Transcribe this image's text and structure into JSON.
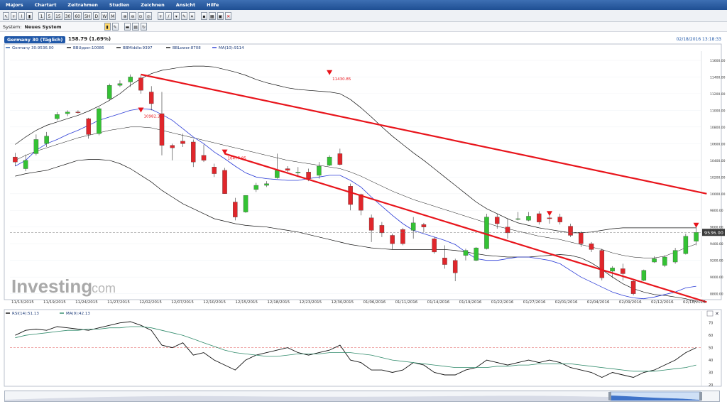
{
  "menu": [
    "Majors",
    "Chartart",
    "Zeitrahmen",
    "Studien",
    "Zeichnen",
    "Ansicht",
    "Hilfe"
  ],
  "toolbar": {
    "timeframes": [
      "1",
      "5",
      "15",
      "30",
      "60",
      "5H",
      "D",
      "W",
      "M"
    ]
  },
  "system": {
    "label": "System:",
    "value": "Neues System"
  },
  "instrument": {
    "name": "Germany 30 (Täglich)",
    "change": "158.79 (1.69%)",
    "datetime": "02/18/2016 13:18:33"
  },
  "colors": {
    "up": "#34c234",
    "down": "#e0262b",
    "ma": "#2a3bd6",
    "channel": "#e8141b",
    "bb": "#111111",
    "rsi": "#111111",
    "rsi_ma": "#2f8a6a",
    "ref": "#e05050"
  },
  "watermark": {
    "brand": "Investing",
    "suffix": ".com"
  },
  "chart_data": [
    {
      "type": "candlestick",
      "legend": [
        {
          "label": "Germany 30:9536.00",
          "color": "#1f57a8"
        },
        {
          "label": "BBUpper:10086",
          "color": "#111111"
        },
        {
          "label": "BBMiddle:9397",
          "color": "#111111"
        },
        {
          "label": "BBLower:8708",
          "color": "#111111"
        },
        {
          "label": "MA(10):9114",
          "color": "#2a3bd6"
        }
      ],
      "ylim": [
        8780,
        11710
      ],
      "yticks": [
        8800,
        9000,
        9200,
        9400,
        9600,
        9800,
        10000,
        10200,
        10400,
        10600,
        10800,
        11000,
        11200,
        11400,
        11600
      ],
      "x_labels": [
        "11/13/2015",
        "11/19/2015",
        "11/24/2015",
        "11/27/2015",
        "12/02/2015",
        "12/07/2015",
        "12/10/2015",
        "12/15/2015",
        "12/18/2015",
        "12/23/2015",
        "12/30/2015",
        "01/06/2016",
        "01/11/2016",
        "01/14/2016",
        "01/19/2016",
        "01/22/2016",
        "01/27/2016",
        "02/01/2016",
        "02/04/2016",
        "02/09/2016",
        "02/12/2016",
        "02/18/2016"
      ],
      "current_price": {
        "label": "9536.00",
        "value": 9536
      },
      "annotations": [
        {
          "label": "10982.35",
          "index": 0,
          "value": 10982
        },
        {
          "label": "10477.85",
          "index": 1,
          "value": 10478
        },
        {
          "label": "11430.85",
          "index": 2,
          "value": 11431
        }
      ],
      "candles": [
        {
          "o": 10440,
          "h": 10490,
          "l": 10330,
          "c": 10380
        },
        {
          "o": 10300,
          "h": 10470,
          "l": 10270,
          "c": 10400
        },
        {
          "o": 10480,
          "h": 10710,
          "l": 10460,
          "c": 10650
        },
        {
          "o": 10600,
          "h": 10740,
          "l": 10560,
          "c": 10690
        },
        {
          "o": 10900,
          "h": 10980,
          "l": 10880,
          "c": 10950
        },
        {
          "o": 10960,
          "h": 11000,
          "l": 10930,
          "c": 10980
        },
        {
          "o": 10980,
          "h": 11000,
          "l": 10960,
          "c": 10975
        },
        {
          "o": 10900,
          "h": 10910,
          "l": 10660,
          "c": 10710
        },
        {
          "o": 10720,
          "h": 11040,
          "l": 10700,
          "c": 11020
        },
        {
          "o": 11140,
          "h": 11320,
          "l": 11120,
          "c": 11300
        },
        {
          "o": 11300,
          "h": 11360,
          "l": 11280,
          "c": 11320
        },
        {
          "o": 11340,
          "h": 11430,
          "l": 11280,
          "c": 11400
        },
        {
          "o": 11390,
          "h": 11430,
          "l": 11200,
          "c": 11240
        },
        {
          "o": 11220,
          "h": 11290,
          "l": 11000,
          "c": 11080
        },
        {
          "o": 10960,
          "h": 11220,
          "l": 10460,
          "c": 10580
        },
        {
          "o": 10580,
          "h": 10600,
          "l": 10400,
          "c": 10550
        },
        {
          "o": 10630,
          "h": 10720,
          "l": 10560,
          "c": 10600
        },
        {
          "o": 10620,
          "h": 10650,
          "l": 10320,
          "c": 10380
        },
        {
          "o": 10460,
          "h": 10590,
          "l": 10380,
          "c": 10400
        },
        {
          "o": 10320,
          "h": 10360,
          "l": 10200,
          "c": 10240
        },
        {
          "o": 10280,
          "h": 10310,
          "l": 10000,
          "c": 10000
        },
        {
          "o": 9900,
          "h": 9950,
          "l": 9680,
          "c": 9720
        },
        {
          "o": 9780,
          "h": 9980,
          "l": 9770,
          "c": 9980
        },
        {
          "o": 10050,
          "h": 10130,
          "l": 10020,
          "c": 10100
        },
        {
          "o": 10100,
          "h": 10150,
          "l": 10080,
          "c": 10120
        },
        {
          "o": 10190,
          "h": 10480,
          "l": 10180,
          "c": 10280
        },
        {
          "o": 10300,
          "h": 10330,
          "l": 10260,
          "c": 10280
        },
        {
          "o": 10250,
          "h": 10320,
          "l": 10200,
          "c": 10260
        },
        {
          "o": 10260,
          "h": 10300,
          "l": 10150,
          "c": 10180
        },
        {
          "o": 10220,
          "h": 10380,
          "l": 10180,
          "c": 10330
        },
        {
          "o": 10340,
          "h": 10460,
          "l": 10330,
          "c": 10440
        },
        {
          "o": 10480,
          "h": 10540,
          "l": 10340,
          "c": 10350
        },
        {
          "o": 10090,
          "h": 10120,
          "l": 9800,
          "c": 9870
        },
        {
          "o": 9990,
          "h": 10000,
          "l": 9740,
          "c": 9800
        },
        {
          "o": 9710,
          "h": 9750,
          "l": 9420,
          "c": 9560
        },
        {
          "o": 9620,
          "h": 9660,
          "l": 9480,
          "c": 9530
        },
        {
          "o": 9500,
          "h": 9520,
          "l": 9330,
          "c": 9400
        },
        {
          "o": 9570,
          "h": 9590,
          "l": 9380,
          "c": 9400
        },
        {
          "o": 9560,
          "h": 9720,
          "l": 9460,
          "c": 9650
        },
        {
          "o": 9630,
          "h": 9650,
          "l": 9540,
          "c": 9600
        },
        {
          "o": 9460,
          "h": 9480,
          "l": 9280,
          "c": 9300
        },
        {
          "o": 9230,
          "h": 9380,
          "l": 9100,
          "c": 9150
        },
        {
          "o": 9200,
          "h": 9220,
          "l": 8950,
          "c": 9050
        },
        {
          "o": 9260,
          "h": 9340,
          "l": 9200,
          "c": 9320
        },
        {
          "o": 9200,
          "h": 9360,
          "l": 9190,
          "c": 9350
        },
        {
          "o": 9340,
          "h": 9760,
          "l": 9330,
          "c": 9720
        },
        {
          "o": 9720,
          "h": 9760,
          "l": 9580,
          "c": 9640
        },
        {
          "o": 9600,
          "h": 9700,
          "l": 9460,
          "c": 9530
        },
        {
          "o": 9700,
          "h": 9780,
          "l": 9680,
          "c": 9700
        },
        {
          "o": 9680,
          "h": 9780,
          "l": 9670,
          "c": 9730
        },
        {
          "o": 9760,
          "h": 9790,
          "l": 9630,
          "c": 9660
        },
        {
          "o": 9710,
          "h": 9740,
          "l": 9640,
          "c": 9700
        },
        {
          "o": 9720,
          "h": 9760,
          "l": 9630,
          "c": 9660
        },
        {
          "o": 9610,
          "h": 9640,
          "l": 9480,
          "c": 9500
        },
        {
          "o": 9530,
          "h": 9550,
          "l": 9360,
          "c": 9400
        },
        {
          "o": 9400,
          "h": 9420,
          "l": 9300,
          "c": 9330
        },
        {
          "o": 9320,
          "h": 9340,
          "l": 8960,
          "c": 8990
        },
        {
          "o": 9070,
          "h": 9130,
          "l": 8990,
          "c": 9110
        },
        {
          "o": 9100,
          "h": 9160,
          "l": 8960,
          "c": 9040
        },
        {
          "o": 8950,
          "h": 8980,
          "l": 8780,
          "c": 8800
        },
        {
          "o": 8960,
          "h": 9090,
          "l": 8950,
          "c": 9080
        },
        {
          "o": 9180,
          "h": 9250,
          "l": 9170,
          "c": 9220
        },
        {
          "o": 9140,
          "h": 9260,
          "l": 9120,
          "c": 9240
        },
        {
          "o": 9180,
          "h": 9350,
          "l": 9160,
          "c": 9320
        },
        {
          "o": 9280,
          "h": 9520,
          "l": 9270,
          "c": 9490
        },
        {
          "o": 9430,
          "h": 9600,
          "l": 9380,
          "c": 9536
        }
      ],
      "ma10": [
        10330,
        10400,
        10520,
        10600,
        10650,
        10710,
        10760,
        10820,
        10880,
        10920,
        10960,
        11000,
        11020,
        11010,
        10950,
        10880,
        10780,
        10680,
        10600,
        10500,
        10420,
        10330,
        10250,
        10200,
        10180,
        10170,
        10160,
        10160,
        10180,
        10200,
        10220,
        10220,
        10160,
        10080,
        9960,
        9850,
        9740,
        9640,
        9560,
        9520,
        9480,
        9440,
        9390,
        9300,
        9220,
        9200,
        9200,
        9220,
        9240,
        9240,
        9220,
        9200,
        9160,
        9080,
        9000,
        8940,
        8880,
        8820,
        8780,
        8750,
        8740,
        8760,
        8790,
        8820,
        8870,
        8890
      ],
      "bb_upper": [
        10590,
        10680,
        10760,
        10820,
        10860,
        10900,
        10940,
        10990,
        11050,
        11120,
        11200,
        11300,
        11380,
        11440,
        11480,
        11500,
        11520,
        11530,
        11530,
        11520,
        11490,
        11460,
        11420,
        11370,
        11330,
        11300,
        11270,
        11250,
        11240,
        11230,
        11220,
        11200,
        11130,
        11030,
        10920,
        10800,
        10690,
        10590,
        10490,
        10400,
        10300,
        10200,
        10100,
        10000,
        9900,
        9820,
        9760,
        9700,
        9650,
        9620,
        9590,
        9570,
        9550,
        9530,
        9530,
        9540,
        9560,
        9580,
        9590,
        9590,
        9590,
        9590,
        9590,
        9590,
        9590,
        9590
      ],
      "bb_middle": [
        10400,
        10460,
        10510,
        10550,
        10590,
        10630,
        10670,
        10700,
        10730,
        10760,
        10780,
        10800,
        10800,
        10790,
        10760,
        10730,
        10700,
        10670,
        10640,
        10610,
        10580,
        10550,
        10520,
        10490,
        10460,
        10430,
        10400,
        10380,
        10360,
        10340,
        10320,
        10300,
        10260,
        10210,
        10150,
        10090,
        10030,
        9980,
        9930,
        9890,
        9850,
        9810,
        9770,
        9730,
        9690,
        9650,
        9610,
        9580,
        9550,
        9520,
        9490,
        9470,
        9450,
        9420,
        9390,
        9360,
        9330,
        9290,
        9260,
        9240,
        9230,
        9230,
        9250,
        9300,
        9350,
        9397
      ],
      "bb_lower": [
        10210,
        10240,
        10260,
        10280,
        10320,
        10360,
        10400,
        10410,
        10410,
        10400,
        10360,
        10300,
        10220,
        10140,
        10040,
        9960,
        9880,
        9820,
        9760,
        9700,
        9670,
        9640,
        9620,
        9610,
        9600,
        9580,
        9560,
        9540,
        9510,
        9480,
        9450,
        9420,
        9390,
        9370,
        9350,
        9340,
        9330,
        9330,
        9330,
        9330,
        9330,
        9330,
        9320,
        9300,
        9280,
        9260,
        9250,
        9240,
        9240,
        9240,
        9250,
        9260,
        9270,
        9260,
        9230,
        9170,
        9090,
        9000,
        8920,
        8860,
        8820,
        8790,
        8780,
        8760,
        8740,
        8708
      ],
      "channel": [
        {
          "from": {
            "index": 12,
            "value": 11430
          },
          "to": {
            "index": 66,
            "value": 10000
          }
        },
        {
          "from": {
            "index": 20,
            "value": 10480
          },
          "to": {
            "index": 66,
            "value": 8700
          }
        }
      ]
    },
    {
      "type": "line",
      "legend": [
        {
          "label": "RSI(14):51.13",
          "color": "#111111"
        },
        {
          "label": "MA(9):42.13",
          "color": "#2f8a6a"
        }
      ],
      "ylim": [
        20,
        75
      ],
      "yticks": [
        20,
        30,
        40,
        50,
        60,
        70
      ],
      "reference_line": 50,
      "series": [
        {
          "name": "RSI(14)",
          "values": [
            60,
            64,
            65,
            64,
            67,
            66,
            65,
            64,
            66,
            68,
            70,
            71,
            68,
            64,
            52,
            50,
            54,
            44,
            46,
            40,
            36,
            32,
            40,
            44,
            46,
            48,
            50,
            46,
            44,
            46,
            48,
            52,
            40,
            38,
            32,
            32,
            30,
            32,
            38,
            36,
            30,
            28,
            28,
            32,
            34,
            40,
            38,
            36,
            38,
            40,
            38,
            40,
            38,
            34,
            32,
            30,
            26,
            30,
            28,
            26,
            30,
            32,
            36,
            40,
            46,
            50
          ]
        },
        {
          "name": "MA(9)",
          "values": [
            58,
            60,
            61,
            62,
            63,
            64,
            64,
            65,
            65,
            66,
            66,
            67,
            67,
            66,
            64,
            62,
            60,
            57,
            54,
            51,
            48,
            46,
            45,
            44,
            43,
            43,
            44,
            45,
            45,
            45,
            46,
            46,
            46,
            45,
            44,
            42,
            40,
            39,
            38,
            37,
            36,
            35,
            34,
            34,
            34,
            34,
            35,
            35,
            36,
            36,
            37,
            37,
            37,
            37,
            36,
            35,
            34,
            33,
            32,
            31,
            31,
            31,
            32,
            33,
            34,
            36
          ]
        }
      ]
    }
  ]
}
